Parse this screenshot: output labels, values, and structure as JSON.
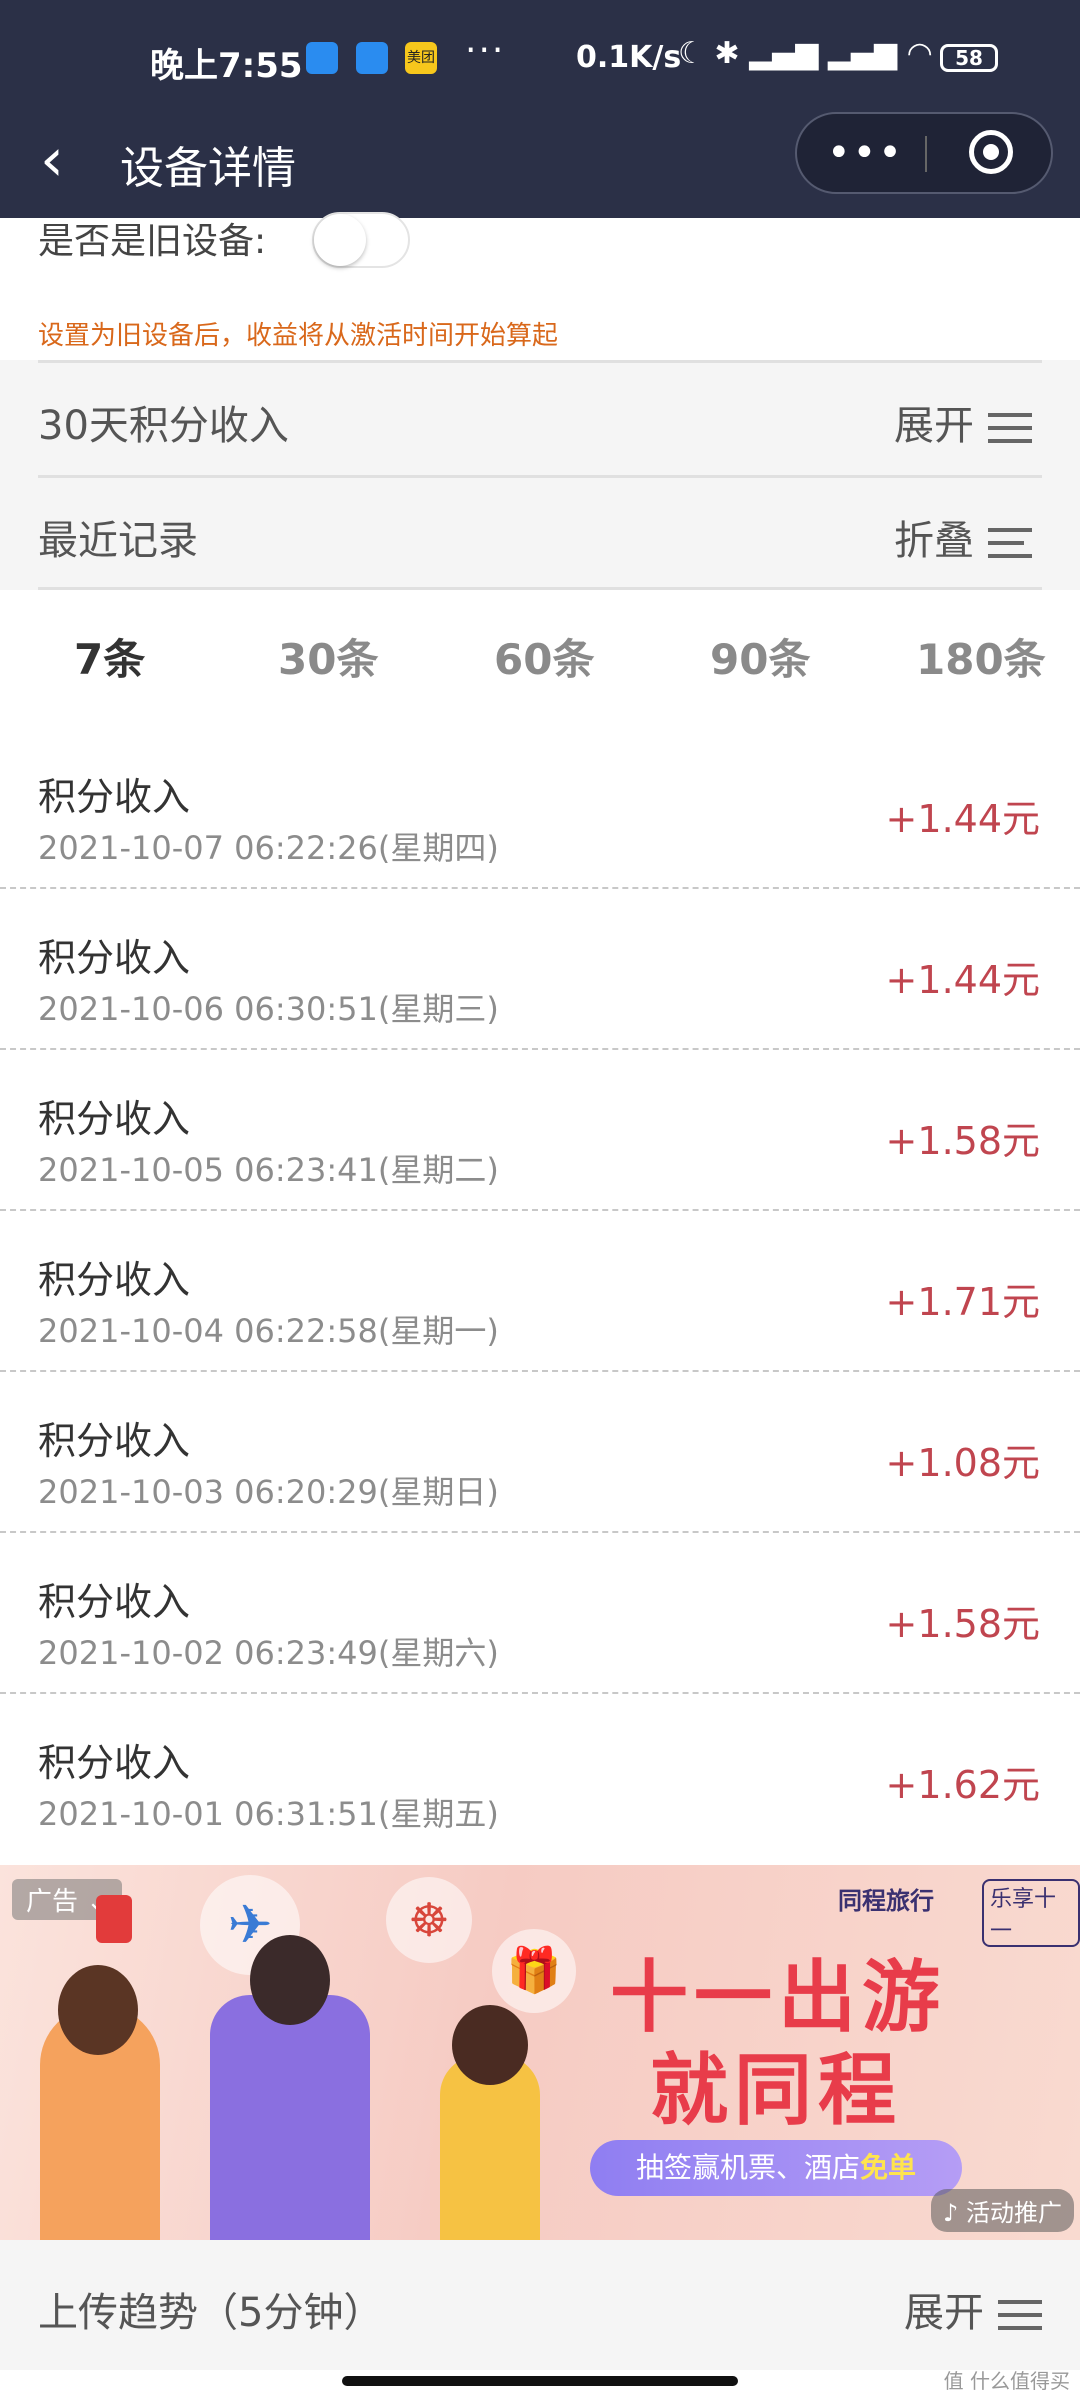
{
  "status_bar": {
    "time": "晚上7:55",
    "app_badge_text": "美团",
    "more": "···",
    "net_speed": "0.1K/s",
    "battery": "58"
  },
  "navbar": {
    "back_icon": "chevron-left-icon",
    "title": "设备详情",
    "more_icon": "more-dots-icon",
    "close_icon": "target-close-icon"
  },
  "old_device": {
    "label": "是否是旧设备:",
    "enabled": false,
    "hint": "设置为旧设备后，收益将从激活时间开始算起"
  },
  "sections": [
    {
      "title": "30天积分收入",
      "action": "展开"
    },
    {
      "title": "最近记录",
      "action": "折叠"
    }
  ],
  "tabs": [
    {
      "label": "7条",
      "active": true
    },
    {
      "label": "30条",
      "active": false
    },
    {
      "label": "60条",
      "active": false
    },
    {
      "label": "90条",
      "active": false
    },
    {
      "label": "180条",
      "active": false
    }
  ],
  "records": [
    {
      "title": "积分收入",
      "time": "2021-10-07 06:22:26(星期四)",
      "amount": "+1.44元"
    },
    {
      "title": "积分收入",
      "time": "2021-10-06 06:30:51(星期三)",
      "amount": "+1.44元"
    },
    {
      "title": "积分收入",
      "time": "2021-10-05 06:23:41(星期二)",
      "amount": "+1.58元"
    },
    {
      "title": "积分收入",
      "time": "2021-10-04 06:22:58(星期一)",
      "amount": "+1.71元"
    },
    {
      "title": "积分收入",
      "time": "2021-10-03 06:20:29(星期日)",
      "amount": "+1.08元"
    },
    {
      "title": "积分收入",
      "time": "2021-10-02 06:23:49(星期六)",
      "amount": "+1.58元"
    },
    {
      "title": "积分收入",
      "time": "2021-10-01 06:31:51(星期五)",
      "amount": "+1.62元"
    }
  ],
  "ad": {
    "tag": "广告 ⌄",
    "brand": "同程旅行",
    "brand_badge": "乐享十一",
    "headline_1": "十一出游",
    "headline_2": "就同程",
    "pill_text": "抽签赢机票、酒店",
    "pill_highlight": "免单",
    "promo": "活动推广"
  },
  "upload": {
    "title": "上传趋势（5分钟）",
    "action": "展开"
  },
  "watermark": "值 什么值得买",
  "colors": {
    "header_bg": "#2b3047",
    "amount": "#c0454f",
    "warning": "#d9681b",
    "ad_headline": "#e83c4a"
  }
}
